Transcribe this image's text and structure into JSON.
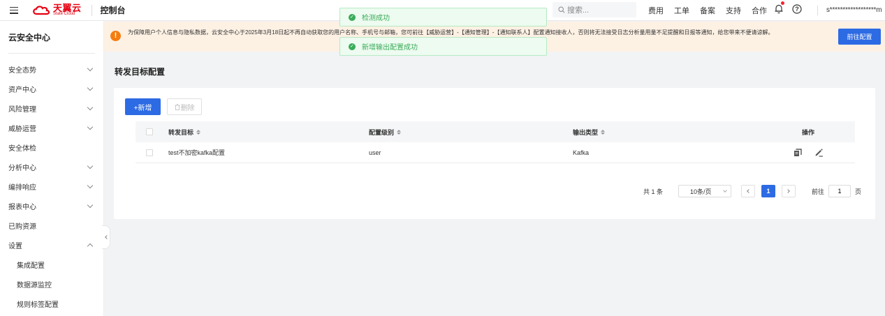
{
  "topbar": {
    "brand_cn": "天翼云",
    "brand_en": "State Cloud",
    "console_title": "控制台",
    "search_placeholder": "搜索...",
    "links": [
      "费用",
      "工单",
      "备案",
      "支持",
      "合作"
    ],
    "user": "s******************m"
  },
  "toasts": {
    "first": "检测成功",
    "second": "新增输出配置成功"
  },
  "notice": {
    "text": "为保障用户个人信息与隐私数据，云安全中心于2025年3月18日起不再自动获取您的用户名称、手机号与邮箱，您可前往【威胁运营】-【通知管理】-【通知联系人】配置通知接收人，否则将无法接受日志分析量用量不足提醒和日报等通知，给您带来不便请谅解。",
    "button": "前往配置"
  },
  "sidebar": {
    "title": "云安全中心",
    "items": [
      {
        "label": "安全态势",
        "arrow": "down"
      },
      {
        "label": "资产中心",
        "arrow": "down"
      },
      {
        "label": "风险管理",
        "arrow": "down"
      },
      {
        "label": "威胁运营",
        "arrow": "down"
      },
      {
        "label": "安全体检",
        "arrow": "none"
      },
      {
        "label": "分析中心",
        "arrow": "down"
      },
      {
        "label": "编排响应",
        "arrow": "down"
      },
      {
        "label": "报表中心",
        "arrow": "down"
      },
      {
        "label": "已购资源",
        "arrow": "none"
      },
      {
        "label": "设置",
        "arrow": "up"
      }
    ],
    "sub_items": [
      "集成配置",
      "数据源监控",
      "规则标签配置"
    ]
  },
  "page": {
    "title": "转发目标配置",
    "add_button": "+新增",
    "delete_button": "删除"
  },
  "table": {
    "columns": [
      "转发目标",
      "配置级别",
      "输出类型",
      "操作"
    ],
    "rows": [
      {
        "target": "test不加密kafka配置",
        "level": "user",
        "type": "Kafka"
      }
    ]
  },
  "pagination": {
    "total": "共 1 条",
    "page_size": "10条/页",
    "current_page": "1",
    "goto_label": "前往",
    "goto_value": "1",
    "page_suffix": "页"
  },
  "colors": {
    "primary": "#2d6be4",
    "success": "#3aac59",
    "warning": "#f57d0f",
    "brand": "#e60012"
  }
}
